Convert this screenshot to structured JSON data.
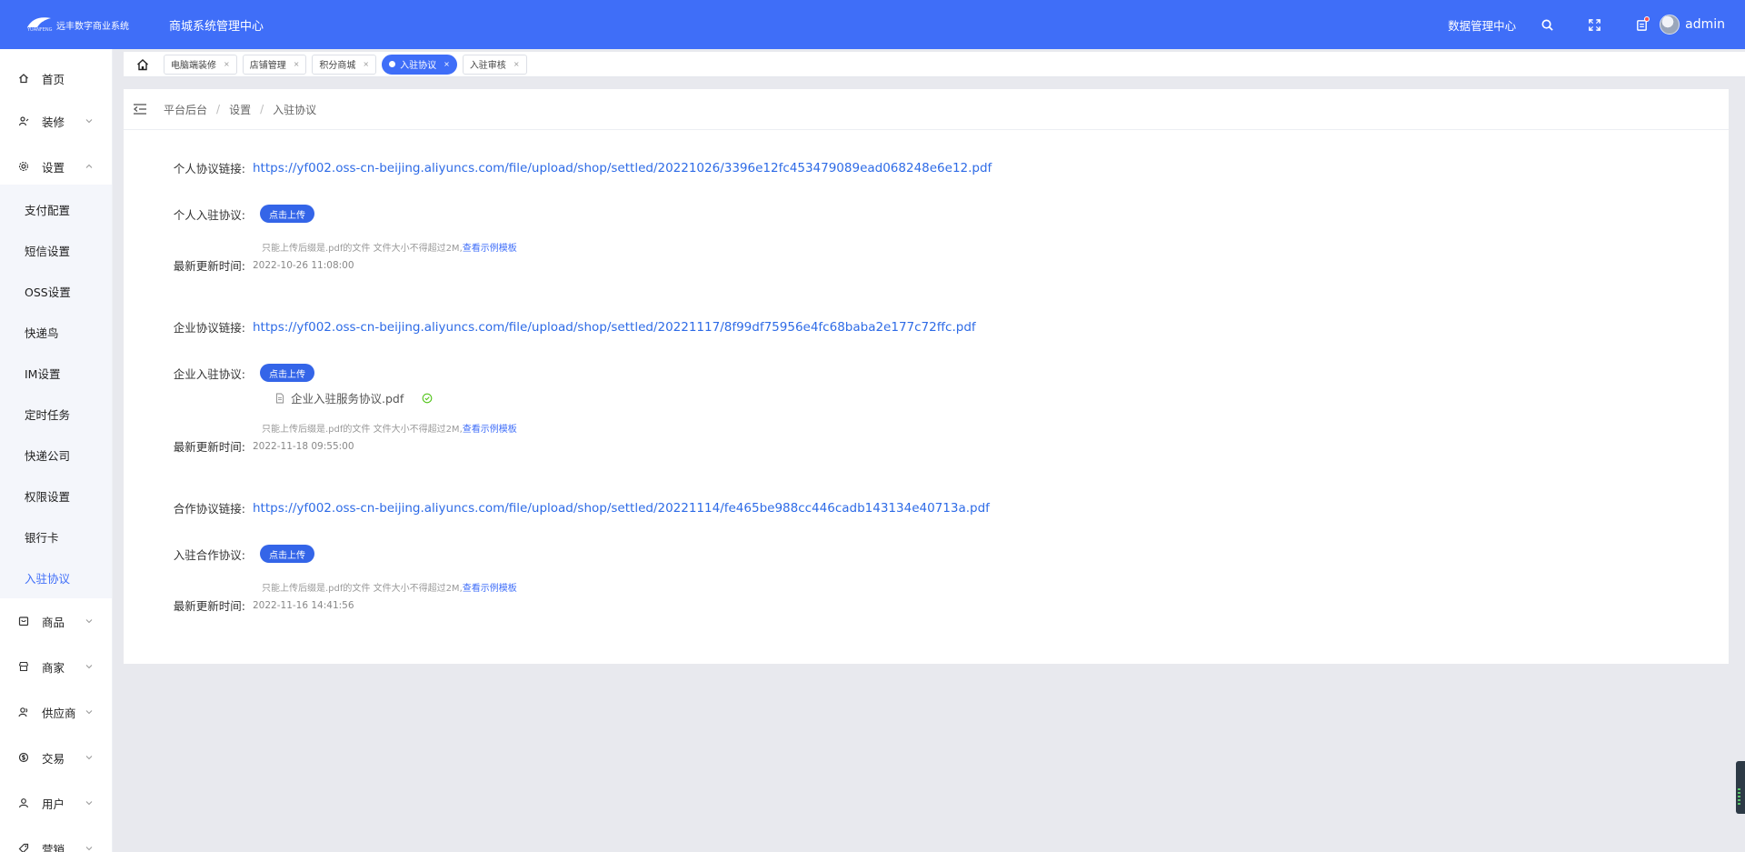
{
  "header": {
    "logo_text": "远丰数字商业系统",
    "logo_sub": "YUANFENG",
    "app_title": "商城系统管理中心",
    "data_center_link": "数据管理中心",
    "username": "admin"
  },
  "sidebar": {
    "items": [
      {
        "label": "首页",
        "icon": "home-icon"
      },
      {
        "label": "装修",
        "icon": "decoration-icon"
      },
      {
        "label": "设置",
        "icon": "gear-icon"
      },
      {
        "label": "商品",
        "icon": "goods-icon"
      },
      {
        "label": "商家",
        "icon": "store-icon"
      },
      {
        "label": "供应商",
        "icon": "supplier-icon"
      },
      {
        "label": "交易",
        "icon": "trade-icon"
      },
      {
        "label": "用户",
        "icon": "user-icon"
      },
      {
        "label": "营销",
        "icon": "marketing-icon"
      }
    ],
    "settings_sub": [
      "支付配置",
      "短信设置",
      "OSS设置",
      "快递鸟",
      "IM设置",
      "定时任务",
      "快递公司",
      "权限设置",
      "银行卡",
      "入驻协议"
    ]
  },
  "tabs": [
    {
      "label": "电脑端装修"
    },
    {
      "label": "店铺管理"
    },
    {
      "label": "积分商城"
    },
    {
      "label": "入驻协议"
    },
    {
      "label": "入驻审核"
    }
  ],
  "tab_close": "×",
  "breadcrumb": [
    "平台后台",
    "设置",
    "入驻协议"
  ],
  "breadcrumb_sep": "/",
  "form": {
    "personal_link_label": "个人协议链接:",
    "personal_link": "https://yf002.oss-cn-beijing.aliyuncs.com/file/upload/shop/settled/20221026/3396e12fc453479089ead068248e6e12.pdf",
    "personal_upload_label": "个人入驻协议:",
    "upload_btn": "点击上传",
    "tip_text": "只能上传后缀是.pdf的文件 文件大小不得超过2M,",
    "tip_link": "查看示例模板",
    "update_time_label": "最新更新时间:",
    "personal_update_time": "2022-10-26 11:08:00",
    "enterprise_link_label": "企业协议链接:",
    "enterprise_link": "https://yf002.oss-cn-beijing.aliyuncs.com/file/upload/shop/settled/20221117/8f99df75956e4fc68baba2e177c72ffc.pdf",
    "enterprise_upload_label": "企业入驻协议:",
    "enterprise_file_name": "企业入驻服务协议.pdf",
    "enterprise_update_time": "2022-11-18 09:55:00",
    "cooperation_link_label": "合作协议链接:",
    "cooperation_link": "https://yf002.oss-cn-beijing.aliyuncs.com/file/upload/shop/settled/20221114/fe465be988cc446cadb143134e40713a.pdf",
    "cooperation_upload_label": "入驻合作协议:",
    "cooperation_update_time": "2022-11-16 14:41:56"
  },
  "colors": {
    "primary": "#3f6ef8",
    "link": "#2e6be6",
    "success": "#52c41a"
  }
}
